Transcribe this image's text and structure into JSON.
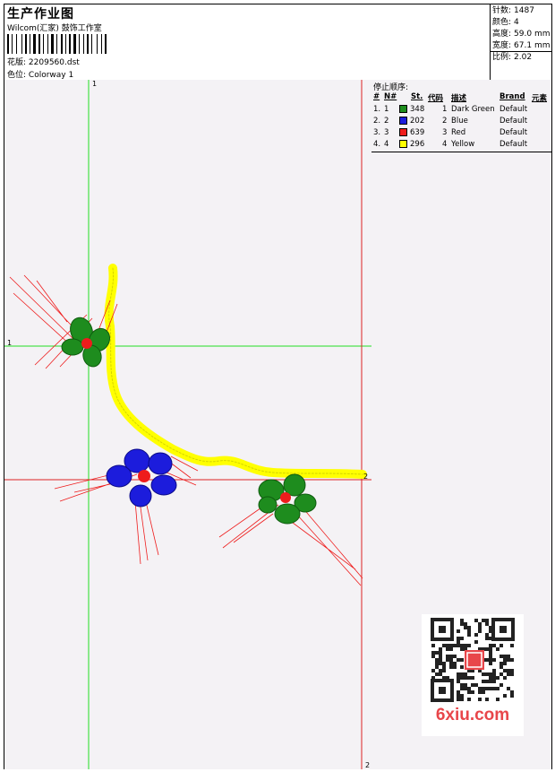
{
  "header": {
    "title": "生产作业图",
    "company": "Wilcom(汇家) 鼓饰工作室",
    "design_label": "花版:",
    "design_value": "2209560.dst",
    "colorway_label": "色位:",
    "colorway_value": "Colorway 1"
  },
  "stats": {
    "stitches_label": "针数:",
    "stitches_value": "1487",
    "colors_label": "颜色:",
    "colors_value": "4",
    "height_label": "高度:",
    "height_value": "59.0 mm",
    "width_label": "宽度:",
    "width_value": "67.1 mm",
    "scale_label": "比例:",
    "scale_value": "2.02"
  },
  "stop_sequence": {
    "title": "停止顺序:",
    "headers": {
      "hash": "#",
      "no": "N#",
      "st": "St.",
      "code": "代码",
      "desc": "描述",
      "brand": "Brand",
      "element": "元素"
    },
    "rows": [
      {
        "idx": "1.",
        "no": "1",
        "color": "#1e8c1e",
        "stitches": "348",
        "code": "1",
        "desc": "Dark Green",
        "brand": "Default"
      },
      {
        "idx": "2.",
        "no": "2",
        "color": "#1c1cdc",
        "stitches": "202",
        "code": "2",
        "desc": "Blue",
        "brand": "Default"
      },
      {
        "idx": "3.",
        "no": "3",
        "color": "#ee1c1c",
        "stitches": "639",
        "code": "3",
        "desc": "Red",
        "brand": "Default"
      },
      {
        "idx": "4.",
        "no": "4",
        "color": "#ffff00",
        "stitches": "296",
        "code": "4",
        "desc": "Yellow",
        "brand": "Default"
      }
    ]
  },
  "canvas_markers": {
    "green_top": "1",
    "green_left": "1",
    "red_right": "2",
    "red_bottom": "2"
  },
  "watermark": {
    "text": "6xiu.com"
  },
  "colors": {
    "guide_green": "#22dd22",
    "guide_red": "#dd2222",
    "thread_green": "#1e8c1e",
    "thread_blue": "#1c1cdc",
    "thread_red": "#ee1c1c",
    "thread_yellow": "#ffff00",
    "watermark_red": "#e8464a"
  }
}
